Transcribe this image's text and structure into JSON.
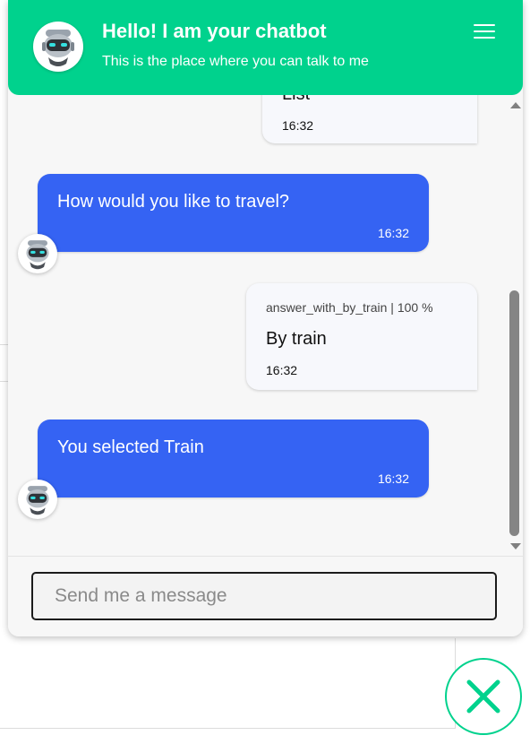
{
  "header": {
    "title": "Hello! I am your chatbot",
    "subtitle": "This is the place where you can talk to me",
    "menu_icon": "hamburger-menu-icon",
    "avatar_icon": "robot-icon"
  },
  "messages": [
    {
      "sender": "user",
      "text": "List",
      "time": "16:32"
    },
    {
      "sender": "bot",
      "text": "How would you like to travel?",
      "time": "16:32"
    },
    {
      "sender": "user",
      "intent": "answer_with_by_train | 100 %",
      "text": "By train",
      "time": "16:32"
    },
    {
      "sender": "bot",
      "text": "You selected Train",
      "time": "16:32"
    }
  ],
  "composer": {
    "placeholder": "Send me a message",
    "value": ""
  },
  "close_button": {
    "icon": "close-icon"
  },
  "colors": {
    "accent": "#00d28d",
    "bot_bubble": "#3563f3",
    "user_bubble": "#f7f8fc",
    "widget_background": "#f7f7f7"
  }
}
